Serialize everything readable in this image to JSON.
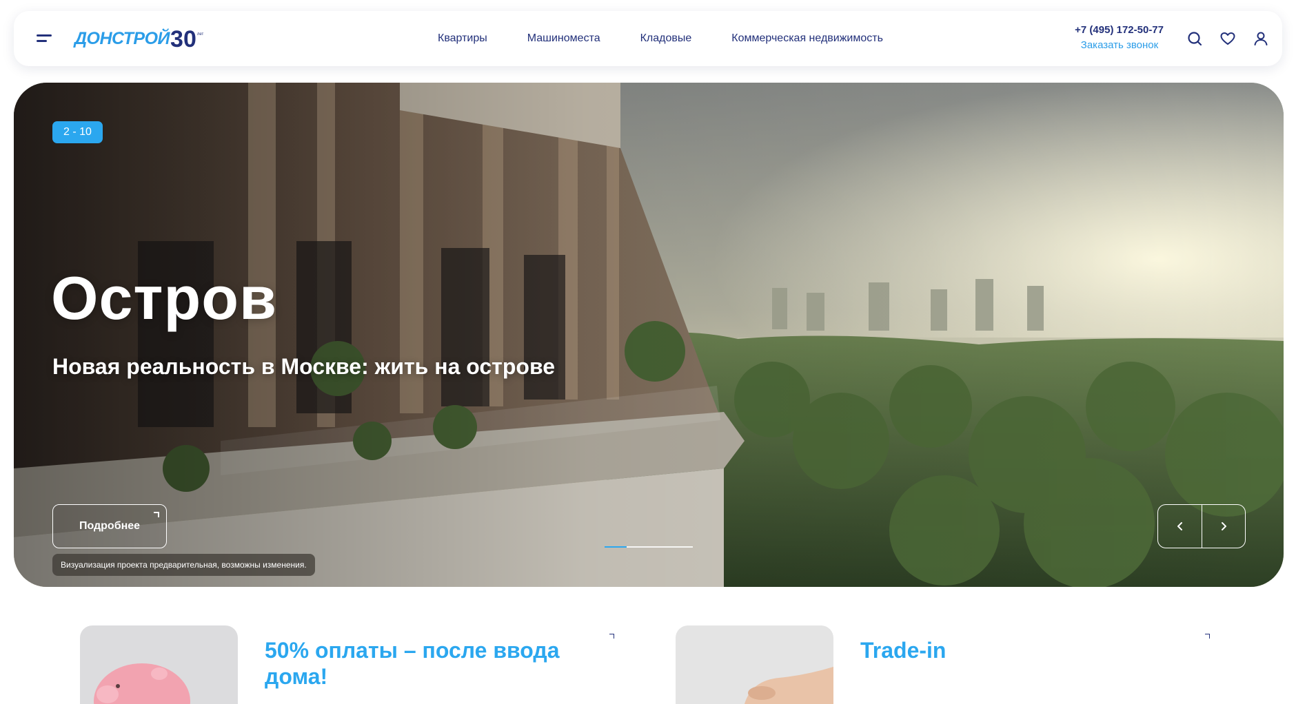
{
  "header": {
    "logo_text": "ДОНСТРОЙ",
    "logo_number": "30",
    "logo_suffix": "лет",
    "nav": [
      "Квартиры",
      "Машиноместа",
      "Кладовые",
      "Коммерческая недвижимость"
    ],
    "phone": "+7 (495) 172-50-77",
    "callback": "Заказать звонок",
    "icons": [
      "menu-icon",
      "search-icon",
      "heart-icon",
      "user-icon"
    ]
  },
  "hero": {
    "badge": "2 - 10",
    "title": "Остров",
    "subtitle": "Новая реальность в Москве: жить на острове",
    "button": "Подробнее",
    "disclaimer": "Визуализация проекта предварительная, возможны изменения.",
    "progress": 0.25,
    "accent": "#2ba7ef"
  },
  "promos": [
    {
      "title": "50% оплаты – после ввода дома!",
      "icon": "piggy-bank-image"
    },
    {
      "title": "Trade-in",
      "icon": "hand-image"
    }
  ],
  "colors": {
    "brand_blue": "#2b9de8",
    "navy": "#22307a",
    "badge": "#2ba7ef"
  }
}
